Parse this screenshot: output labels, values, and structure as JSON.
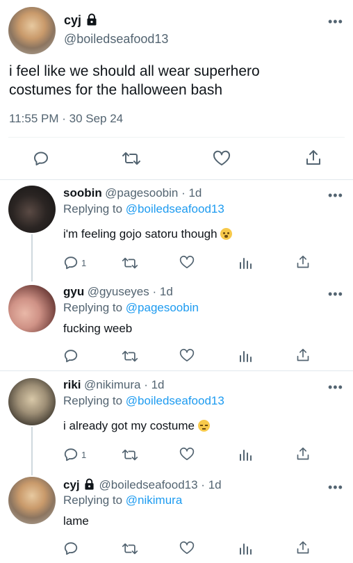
{
  "main_tweet": {
    "name": "cyj",
    "handle": "@boiledseafood13",
    "text_line1": "i feel like we should all wear superhero",
    "text_line2": "costumes for the halloween bash",
    "timestamp": "11:55 PM · 30 Sep 24",
    "avatar": "fennec-fox-avatar",
    "lock_icon": "lock-icon"
  },
  "replies": [
    {
      "name": "soobin",
      "meta": "@pagesoobin · 1d",
      "replying_prefix": "Replying to ",
      "replying_to": "@boiledseafood13",
      "text": "i'm feeling gojo satoru though",
      "emoji": "hushed-face-emoji",
      "reply_count": "1"
    },
    {
      "name": "gyu",
      "meta": "@gyuseyes · 1d",
      "replying_prefix": "Replying to ",
      "replying_to": "@pagesoobin",
      "text": "fucking weeb",
      "reply_count": ""
    },
    {
      "name": "riki",
      "meta": "@nikimura · 1d",
      "replying_prefix": "Replying to ",
      "replying_to": "@boiledseafood13",
      "text": "i already got my costume",
      "emoji": "pensive-face-emoji",
      "reply_count": "1"
    },
    {
      "name": "cyj",
      "meta": "@boiledseafood13 · 1d",
      "replying_prefix": "Replying to ",
      "replying_to": "@nikimura",
      "text": "lame",
      "reply_count": ""
    }
  ],
  "colors": {
    "accent": "#1d9bf0",
    "secondary_text": "#536471",
    "primary_text": "#0f1419",
    "divider": "#eff3f4"
  }
}
